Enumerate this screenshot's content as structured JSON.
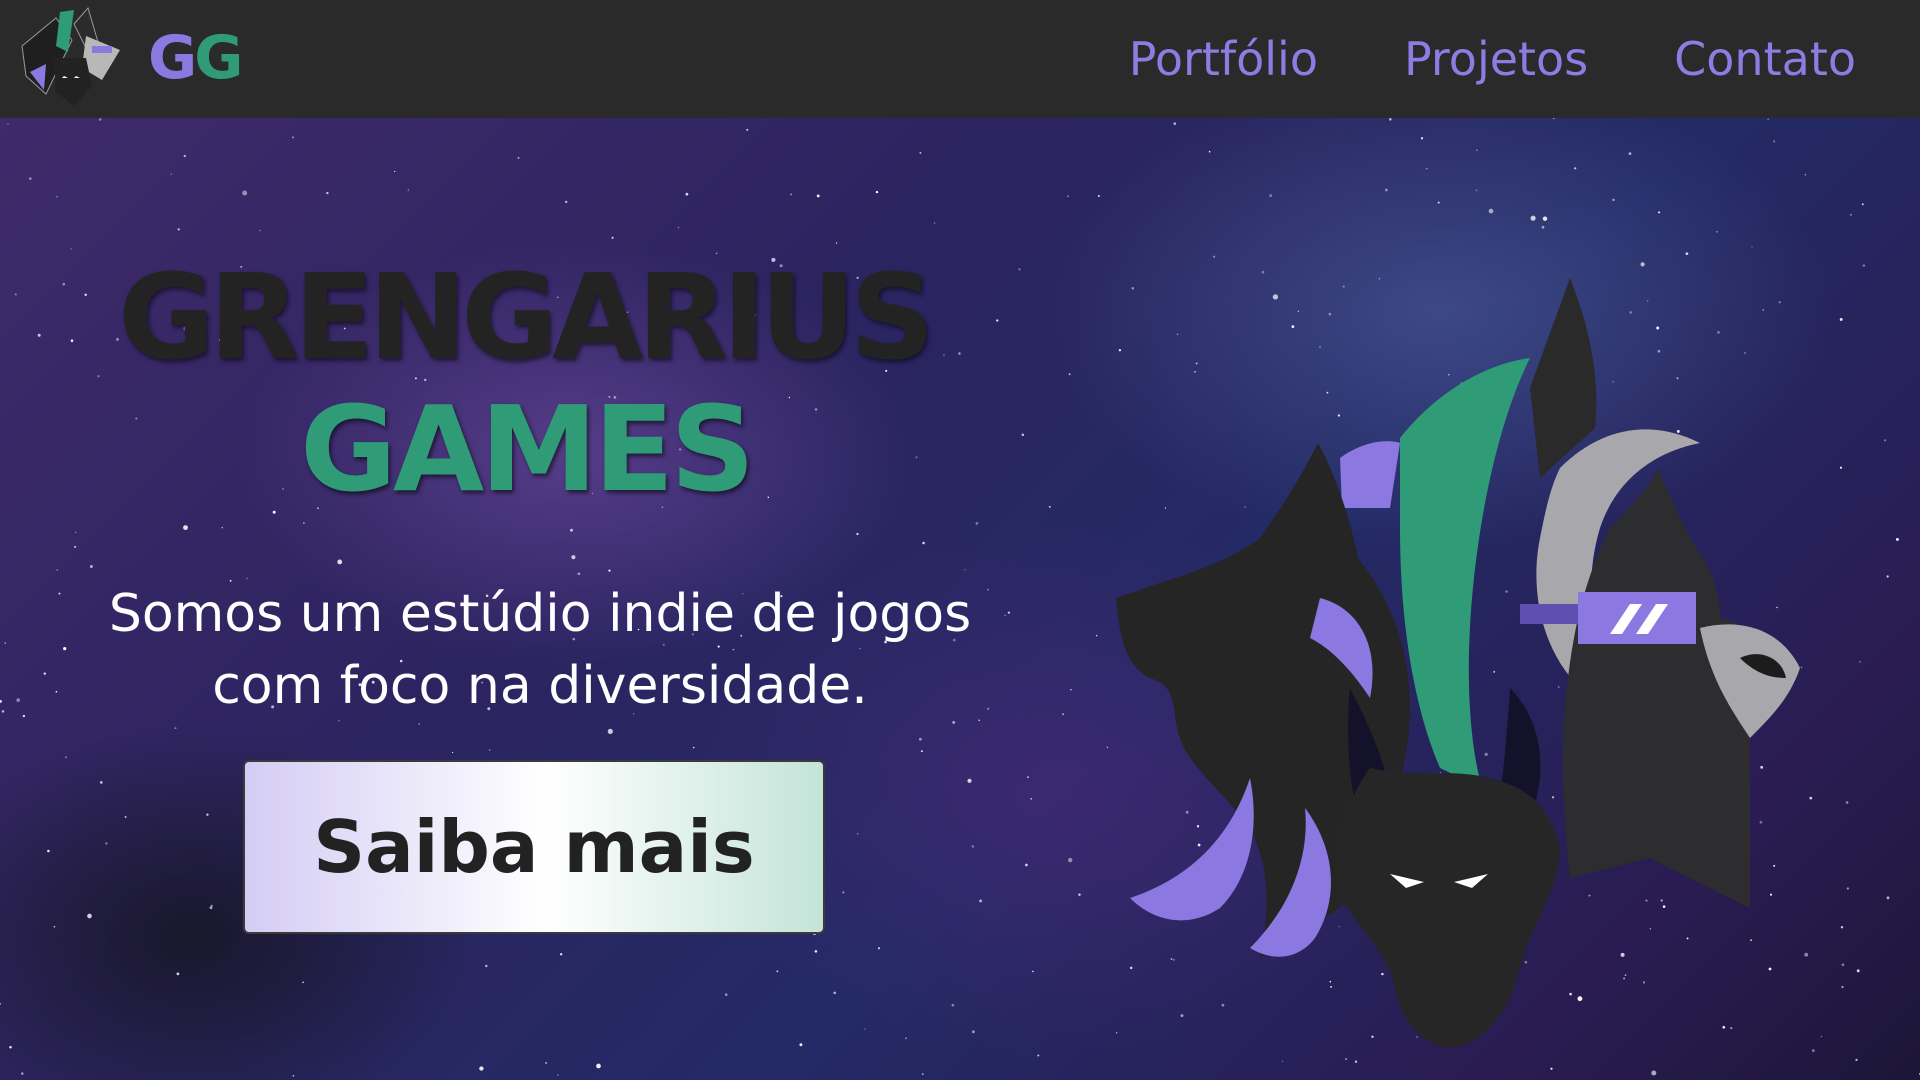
{
  "header": {
    "brand_letter_1": "G",
    "brand_letter_2": "G",
    "nav": [
      {
        "label": "Portfólio"
      },
      {
        "label": "Projetos"
      },
      {
        "label": "Contato"
      }
    ]
  },
  "hero": {
    "title_line_1": "GRENGARIUS",
    "title_line_2": "GAMES",
    "tagline": "Somos um estúdio indie de jogos com foco na diversidade.",
    "cta_label": "Saiba mais"
  },
  "colors": {
    "brand_green": "#2f9c77",
    "brand_purple": "#8b78e0",
    "header_bg": "#2a2a2a",
    "title_dark": "#232323"
  },
  "icons": {
    "logo": "wolf-mascot-icon",
    "hero_art": "wolf-trio-mascot-icon"
  }
}
